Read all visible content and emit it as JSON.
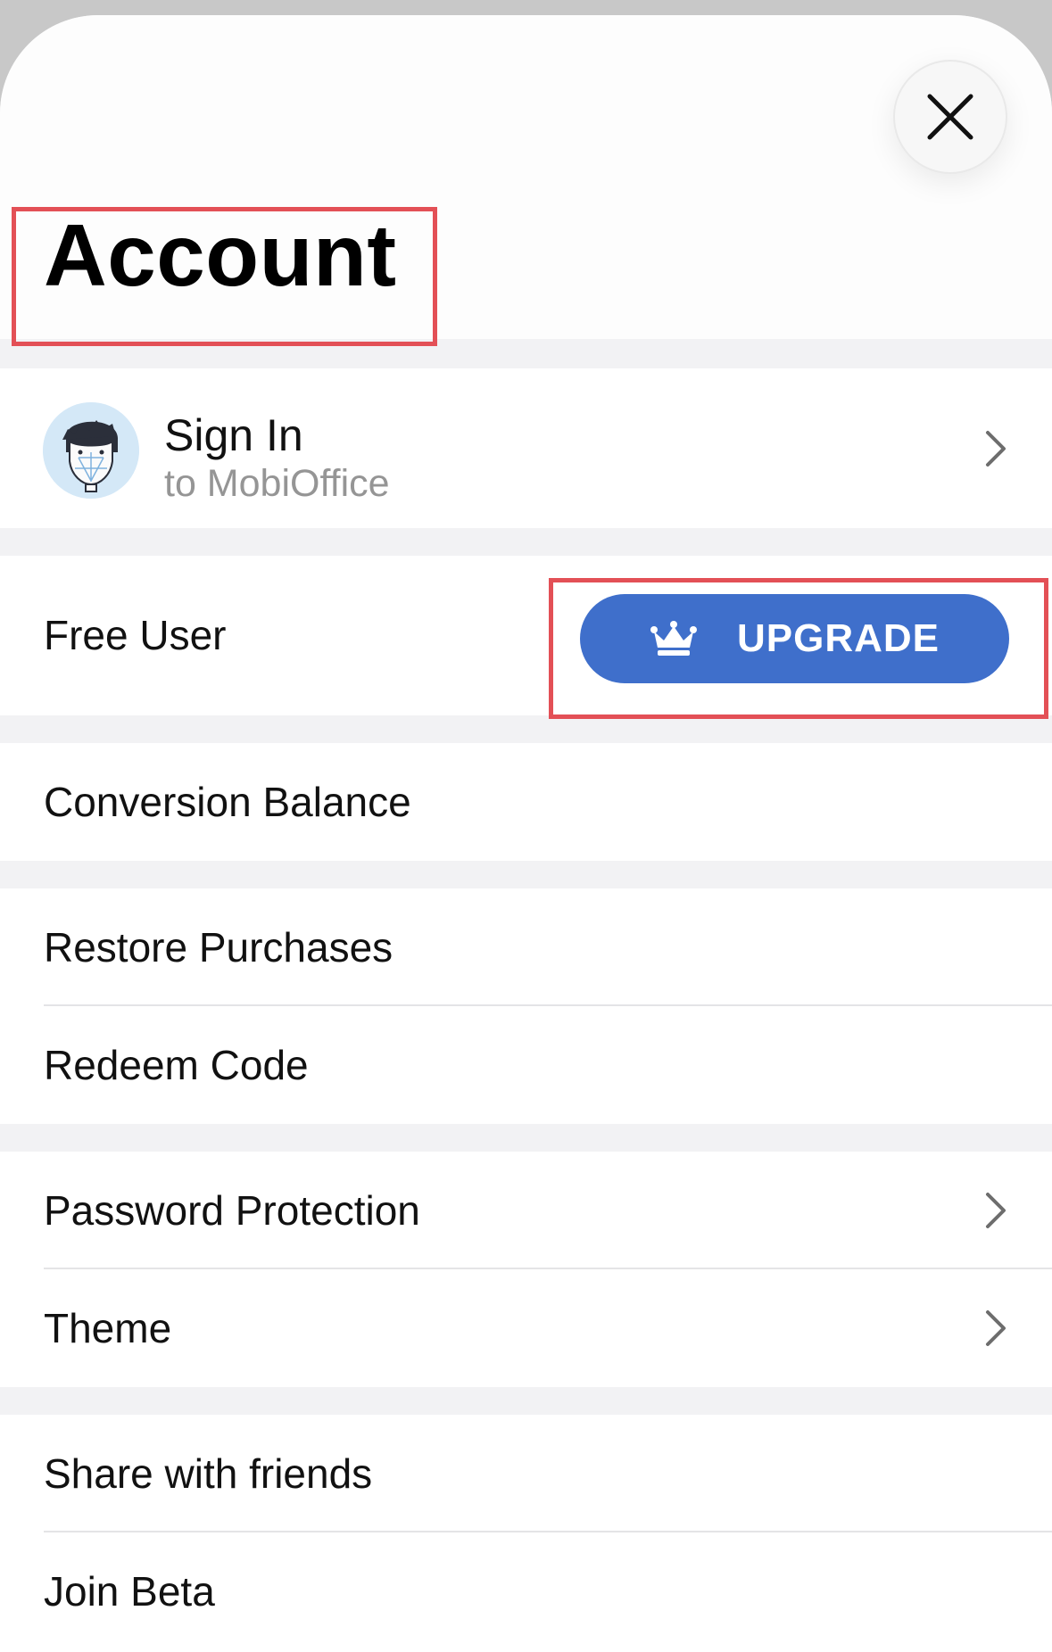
{
  "header": {
    "title": "Account"
  },
  "account": {
    "sign_in_title": "Sign In",
    "sign_in_subtitle": "to MobiOffice",
    "status_label": "Free User",
    "upgrade_label": "UPGRADE"
  },
  "menu": {
    "conversion_balance": "Conversion Balance",
    "restore_purchases": "Restore Purchases",
    "redeem_code": "Redeem Code",
    "password_protection": "Password Protection",
    "theme": "Theme",
    "share_with_friends": "Share with friends",
    "join_beta": "Join Beta"
  },
  "icons": {
    "close": "close-icon",
    "avatar": "face-id-avatar",
    "chevron": "chevron-right-icon",
    "crown": "crown-icon"
  },
  "colors": {
    "accent": "#3f6fcb",
    "highlight": "#e35056",
    "background": "#f2f2f4",
    "card": "#ffffff"
  }
}
